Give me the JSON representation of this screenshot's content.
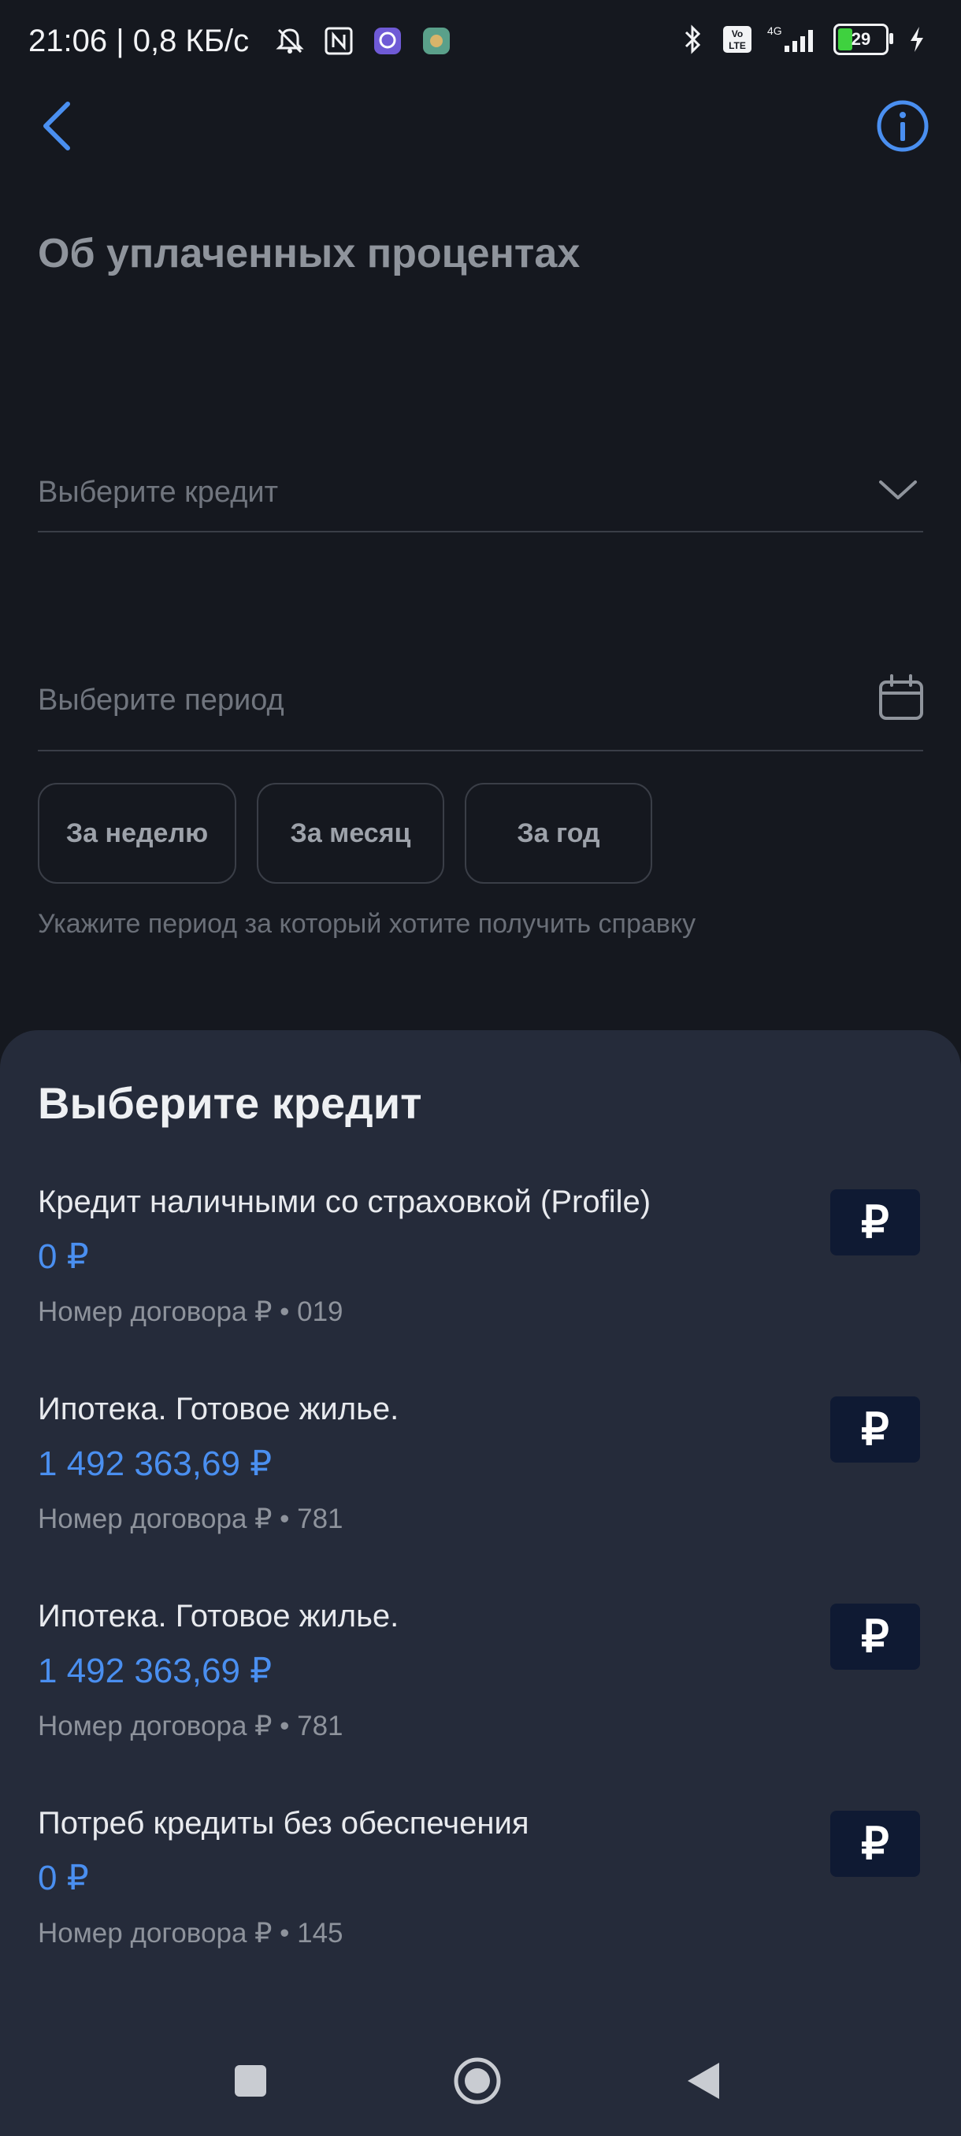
{
  "status_bar": {
    "time_speed": "21:06 | 0,8 КБ/с",
    "network": "4G",
    "volte": "Vo LTE",
    "battery": "29"
  },
  "header": {
    "title": "Об уплаченных процентах"
  },
  "form": {
    "credit_placeholder": "Выберите кредит",
    "period_placeholder": "Выберите период",
    "chips": [
      "За неделю",
      "За месяц",
      "За год"
    ],
    "hint": "Укажите период за который хотите получить справку"
  },
  "sheet": {
    "title": "Выберите кредит",
    "loans": [
      {
        "name": "Кредит наличными со страховкой (Profile)",
        "amount": "0 ₽",
        "contract": "Номер договора ₽ • 019",
        "icon": "₽"
      },
      {
        "name": "Ипотека. Готовое жилье.",
        "amount": "1 492 363,69 ₽",
        "contract": "Номер договора ₽ • 781",
        "icon": "₽"
      },
      {
        "name": "Ипотека. Готовое жилье.",
        "amount": "1 492 363,69 ₽",
        "contract": "Номер договора ₽ • 781",
        "icon": "₽"
      },
      {
        "name": "Потреб кредиты без обеспечения",
        "amount": "0 ₽",
        "contract": "Номер договора ₽ • 145",
        "icon": "₽"
      }
    ]
  },
  "colors": {
    "background": "#15181f",
    "sheet": "#252b3a",
    "accent": "#4a8ff0",
    "icon_bg": "#0f1a33"
  },
  "icons": {
    "back": "chevron-left-icon",
    "info": "info-icon",
    "dropdown": "chevron-down-icon",
    "calendar": "calendar-icon",
    "loan": "ruble-icon"
  }
}
